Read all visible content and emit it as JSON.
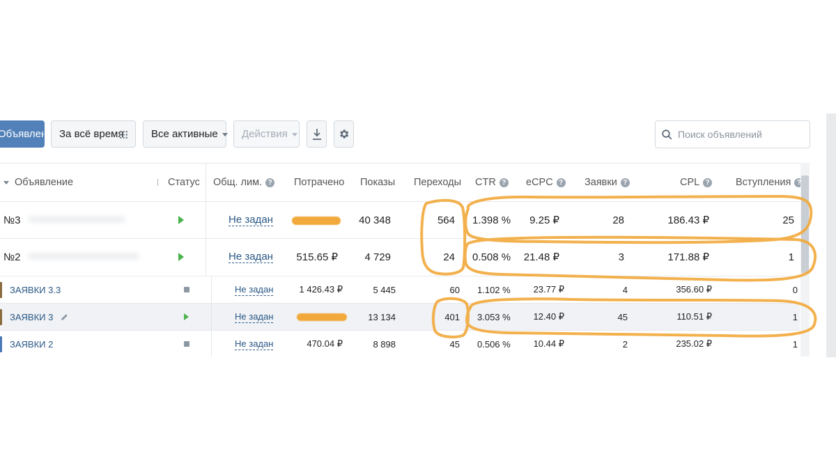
{
  "toolbar": {
    "create_button": "Объявление",
    "period": "За всё время",
    "filter": "Все активные",
    "actions": "Действия",
    "search_placeholder": "Поиск объявлений"
  },
  "table": {
    "headers": {
      "ad": "Объявление",
      "status": "Статус",
      "limit": "Общ. лим.",
      "spent": "Потрачено",
      "impressions": "Показы",
      "clicks": "Переходы",
      "ctr": "CTR",
      "ecpc": "eCPC",
      "leads": "Заявки",
      "cpl": "CPL",
      "joins": "Вступления"
    },
    "rows": [
      {
        "name": "№3",
        "status": "active",
        "limit": "Не задан",
        "spent": "",
        "impressions": "40 348",
        "clicks": "564",
        "ctr": "1.398 %",
        "ecpc": "9.25 ₽",
        "leads": "28",
        "cpl": "186.43 ₽",
        "joins": "25"
      },
      {
        "name": "№2",
        "status": "active",
        "limit": "Не задан",
        "spent": "515.65 ₽",
        "impressions": "4 729",
        "clicks": "24",
        "ctr": "0.508 %",
        "ecpc": "21.48 ₽",
        "leads": "3",
        "cpl": "171.88 ₽",
        "joins": "1"
      },
      {
        "name": "ЗАЯВКИ 3.3",
        "status": "stopped",
        "limit": "Не задан",
        "spent": "1 426.43 ₽",
        "impressions": "5 445",
        "clicks": "60",
        "ctr": "1.102 %",
        "ecpc": "23.77 ₽",
        "leads": "4",
        "cpl": "356.60 ₽",
        "joins": "0"
      },
      {
        "name": "ЗАЯВКИ 3",
        "status": "active",
        "limit": "Не задан",
        "spent": "",
        "impressions": "13 134",
        "clicks": "401",
        "ctr": "3.053 %",
        "ecpc": "12.40 ₽",
        "leads": "45",
        "cpl": "110.51 ₽",
        "joins": "1"
      },
      {
        "name": "ЗАЯВКИ 2",
        "status": "stopped",
        "limit": "Не задан",
        "spent": "470.04 ₽",
        "impressions": "8 898",
        "clicks": "45",
        "ctr": "0.506 %",
        "ecpc": "10.44 ₽",
        "leads": "2",
        "cpl": "235.02 ₽",
        "joins": "1"
      }
    ]
  },
  "colors": {
    "primary": "#5181b8",
    "link": "#2a5885",
    "active": "#4bb34b",
    "highlight": "#f2a93b"
  },
  "icons": {
    "period": "grid-icon",
    "download": "download-icon",
    "settings": "gear-icon",
    "search": "search-icon",
    "active_status": "play-icon",
    "stopped_status": "stop-icon",
    "edit": "pencil-icon",
    "help": "help-icon"
  }
}
